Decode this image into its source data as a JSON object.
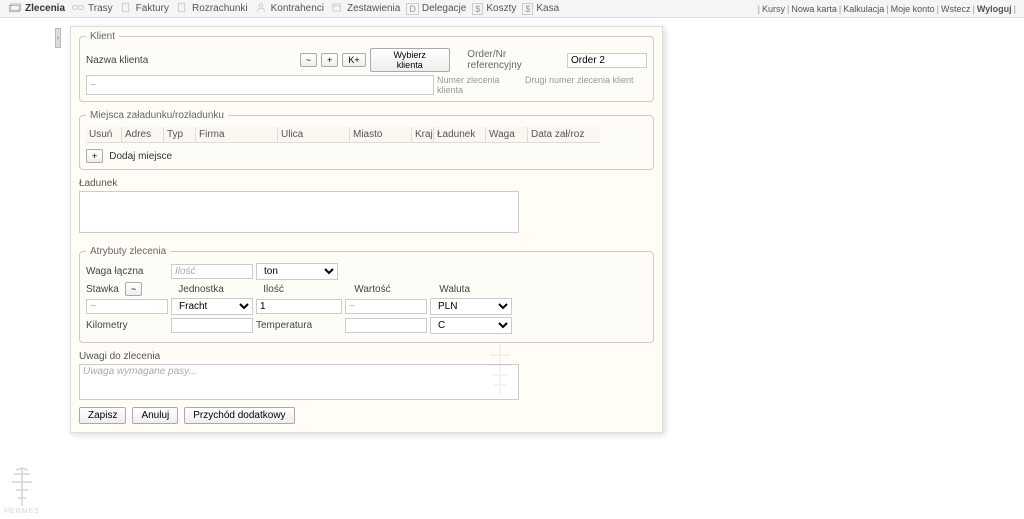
{
  "nav": {
    "zlecenia": "Zlecenia",
    "trasy": "Trasy",
    "faktury": "Faktury",
    "rozrachunki": "Rozrachunki",
    "kontrahenci": "Kontrahenci",
    "zestawienia": "Zestawienia",
    "delegacje": "Delegacje",
    "koszty": "Koszty",
    "kasa": "Kasa"
  },
  "user": {
    "kursy": "Kursy",
    "nowa_karta": "Nowa karta",
    "kalkulacja": "Kalkulacja",
    "moje_konto": "Moje konto",
    "wstecz": "Wstecz",
    "wyloguj": "Wyloguj"
  },
  "client": {
    "legend": "Klient",
    "name_label": "Nazwa klienta",
    "btn_tilde": "~",
    "btn_plus": "+",
    "btn_kplus": "K+",
    "btn_wybierz": "Wybierz klienta",
    "order_label": "Order/Nr referencyjny",
    "order2_label": "Order 2",
    "sub_placeholder": "~",
    "sub_numer": "Numer zlecenia klienta",
    "sub_drugi": "Drugi numer zlecenia klient"
  },
  "miejsca": {
    "legend": "Miejsca załadunku/rozładunku",
    "cols": {
      "usun": "Usuń",
      "adres": "Adres",
      "typ": "Typ",
      "firma": "Firma",
      "ulica": "Ulica",
      "miasto": "Miasto",
      "kraj": "Kraj",
      "ladunek": "Ładunek",
      "waga": "Waga",
      "data": "Data zał/roz"
    },
    "add_btn": "+",
    "add_label": "Dodaj miejsce"
  },
  "ladunek": {
    "label": "Ładunek"
  },
  "atrybuty": {
    "legend": "Atrybuty zlecenia",
    "waga_laczna": "Waga łączna",
    "ilosc_ph": "Ilość",
    "ton": "ton",
    "stawka": "Stawka",
    "stawka_btn": "~",
    "stawka_ph": "~",
    "jednostka": "Jednostka",
    "ilosc": "Ilość",
    "wartosc": "Wartość",
    "waluta": "Waluta",
    "fracht": "Fracht",
    "ilosc_val": "1",
    "wartosc_ph": "~",
    "pln": "PLN",
    "kilometry": "Kilometry",
    "temperatura": "Temperatura",
    "c": "C"
  },
  "uwagi": {
    "label": "Uwagi do zlecenia",
    "placeholder": "Uwaga wymagane pasy..."
  },
  "actions": {
    "zapisz": "Zapisz",
    "anuluj": "Anuluj",
    "przychod": "Przychód dodatkowy"
  },
  "footer": {
    "brand": "HERMES"
  }
}
